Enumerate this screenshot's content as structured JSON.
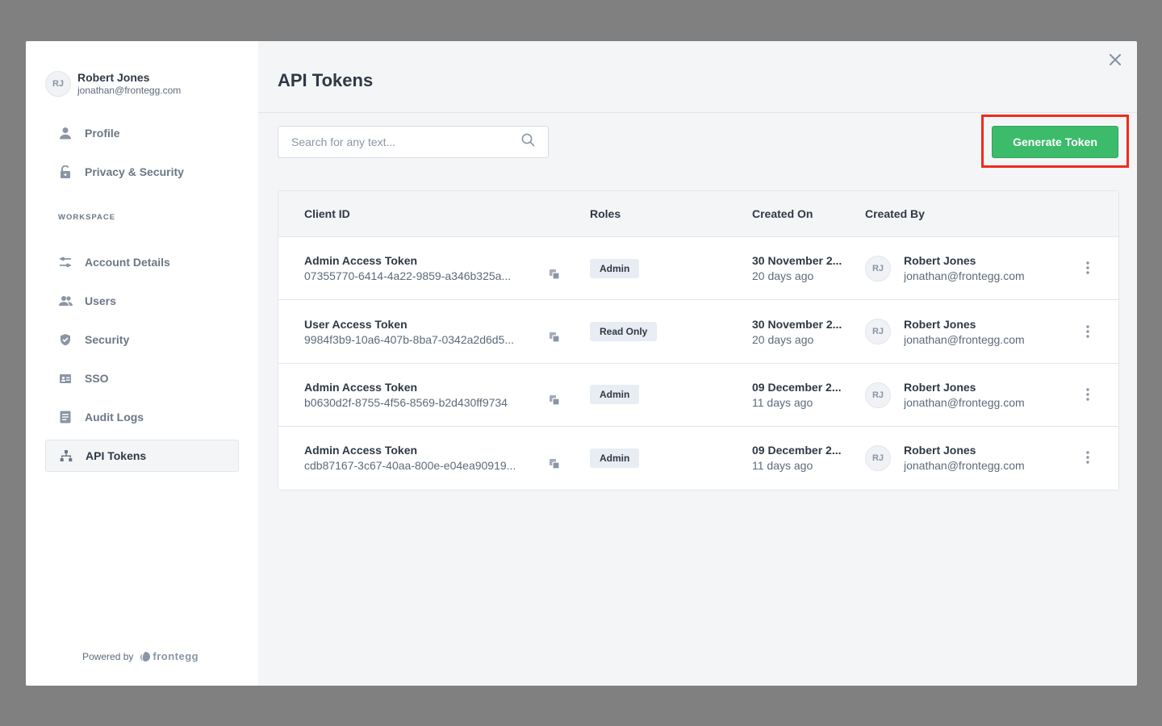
{
  "user": {
    "initials": "RJ",
    "name": "Robert Jones",
    "email": "jonathan@frontegg.com"
  },
  "sidebar": {
    "items": [
      {
        "label": "Profile",
        "icon": "person-icon"
      },
      {
        "label": "Privacy & Security",
        "icon": "lock-icon"
      }
    ],
    "workspace_label": "WORKSPACE",
    "workspace_items": [
      {
        "label": "Account Details",
        "icon": "sliders-icon"
      },
      {
        "label": "Users",
        "icon": "users-icon"
      },
      {
        "label": "Security",
        "icon": "shield-icon"
      },
      {
        "label": "SSO",
        "icon": "sso-icon"
      },
      {
        "label": "Audit Logs",
        "icon": "document-icon"
      },
      {
        "label": "API Tokens",
        "icon": "hierarchy-icon",
        "active": true
      }
    ],
    "powered_by": "Powered by",
    "brand": "frontegg"
  },
  "main": {
    "title": "API Tokens",
    "search": {
      "placeholder": "Search for any text...",
      "value": ""
    },
    "generate_button": "Generate Token",
    "table": {
      "headers": [
        "Client ID",
        "Roles",
        "Created On",
        "Created By"
      ],
      "rows": [
        {
          "name": "Admin Access Token",
          "client_id": "07355770-6414-4a22-9859-a346b325a...",
          "role": "Admin",
          "created_on": "30 November 2...",
          "created_ago": "20 days ago",
          "creator_initials": "RJ",
          "creator_name": "Robert Jones",
          "creator_email": "jonathan@frontegg.com"
        },
        {
          "name": "User Access Token",
          "client_id": "9984f3b9-10a6-407b-8ba7-0342a2d6d5...",
          "role": "Read Only",
          "created_on": "30 November 2...",
          "created_ago": "20 days ago",
          "creator_initials": "RJ",
          "creator_name": "Robert Jones",
          "creator_email": "jonathan@frontegg.com"
        },
        {
          "name": "Admin Access Token",
          "client_id": "b0630d2f-8755-4f56-8569-b2d430ff9734",
          "role": "Admin",
          "created_on": "09 December 2...",
          "created_ago": "11 days ago",
          "creator_initials": "RJ",
          "creator_name": "Robert Jones",
          "creator_email": "jonathan@frontegg.com"
        },
        {
          "name": "Admin Access Token",
          "client_id": "cdb87167-3c67-40aa-800e-e04ea90919...",
          "role": "Admin",
          "created_on": "09 December 2...",
          "created_ago": "11 days ago",
          "creator_initials": "RJ",
          "creator_name": "Robert Jones",
          "creator_email": "jonathan@frontegg.com"
        }
      ]
    }
  },
  "colors": {
    "accent": "#3cbb6b",
    "highlight": "#f12a1c",
    "backdrop": "#808080"
  }
}
